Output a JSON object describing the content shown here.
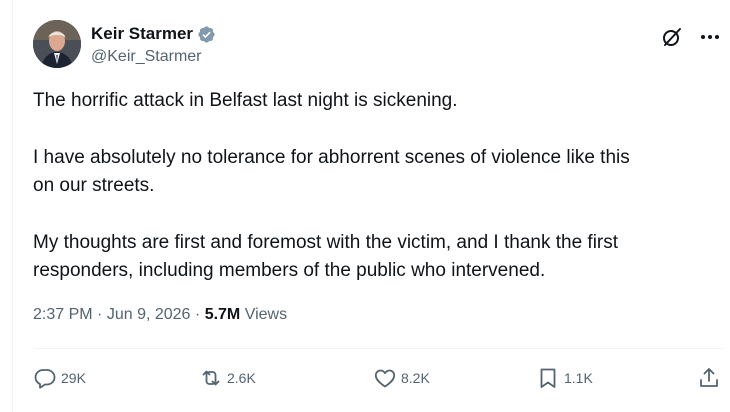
{
  "author": {
    "display_name": "Keir Starmer",
    "handle": "@Keir_Starmer",
    "verified": true,
    "verified_color": "#829aab"
  },
  "header_icons": [
    "grok-icon",
    "more-options-icon"
  ],
  "tweet": {
    "paragraphs": [
      "The horrific attack in Belfast last night is sickening.",
      "I have absolutely no tolerance for abhorrent scenes of violence like this\non our streets.",
      "My thoughts are first and foremost with the victim, and I thank the first\nresponders, including members of the public who intervened."
    ],
    "time": "2:37 PM",
    "separator": "·",
    "date": "Jun 9, 2026",
    "views_count": "5.7M",
    "views_label": "Views"
  },
  "actions": {
    "replies": {
      "icon": "reply-icon",
      "count": "29K"
    },
    "reposts": {
      "icon": "repost-icon",
      "count": "2.6K"
    },
    "likes": {
      "icon": "like-icon",
      "count": "8.2K"
    },
    "bookmarks": {
      "icon": "bookmark-icon",
      "count": "1.1K"
    },
    "share": {
      "icon": "share-icon"
    }
  },
  "colors": {
    "text_primary": "#0f1419",
    "text_secondary": "#536471",
    "divider": "#eff3f4"
  }
}
